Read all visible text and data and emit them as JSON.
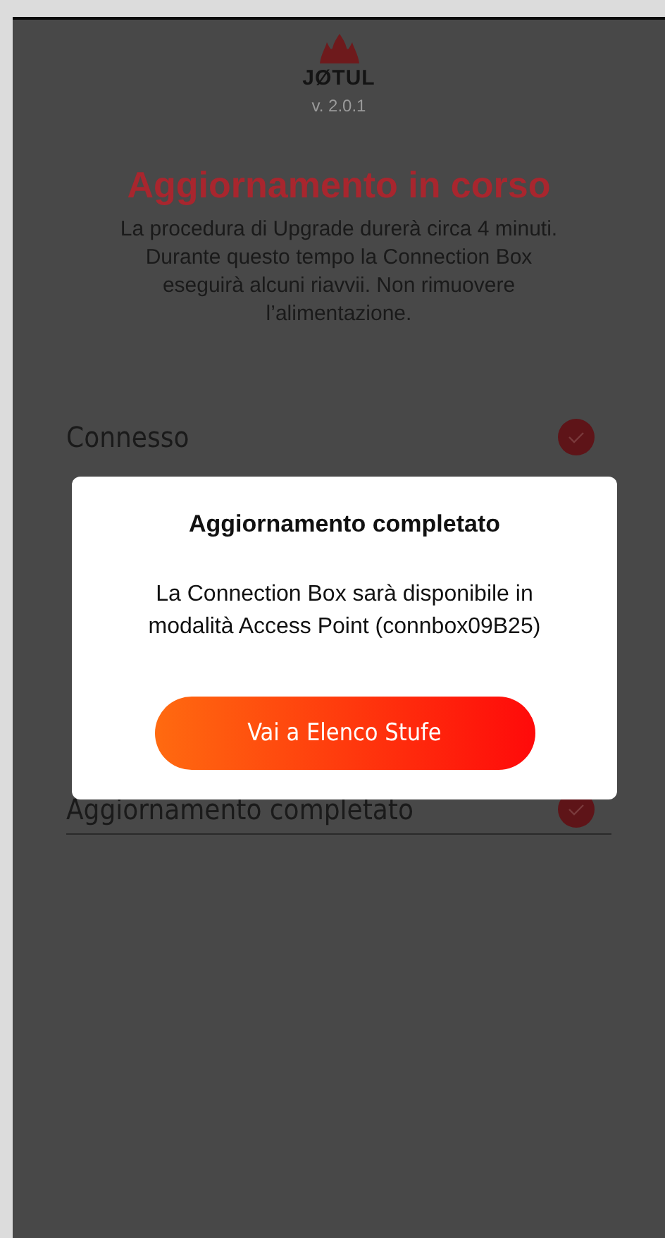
{
  "header": {
    "brand": "JØTUL",
    "version": "v. 2.0.1"
  },
  "title": "Aggiornamento in corso",
  "description": "La procedura di Upgrade durerà circa 4 minuti. Durante questo tempo la Connection Box eseguirà alcuni riavvii. Non rimuovere l’alimentazione.",
  "steps": [
    {
      "label": "Connesso",
      "checked": true
    },
    {
      "label": "Aggiornamento completato",
      "checked": true
    }
  ],
  "dialog": {
    "title": "Aggiornamento completato",
    "message": "La Connection Box sarà disponibile in modalità Access Point (connbox09B25)",
    "button": "Vai a Elenco Stufe"
  }
}
